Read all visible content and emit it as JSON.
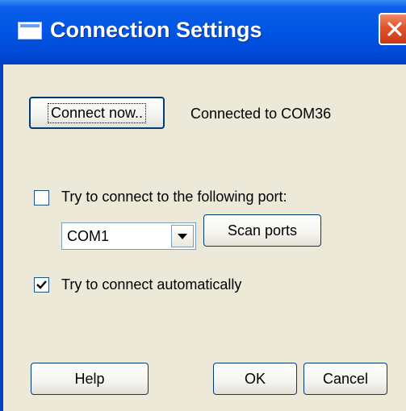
{
  "window": {
    "title": "Connection Settings"
  },
  "connect": {
    "button_label": "Connect now..",
    "status_text": "Connected to COM36"
  },
  "port": {
    "checkbox_label": "Try to connect to the following port:",
    "checked": false,
    "selected_port": "COM1",
    "scan_label": "Scan ports"
  },
  "auto": {
    "checkbox_label": "Try to connect automatically",
    "checked": true
  },
  "footer": {
    "help_label": "Help",
    "ok_label": "OK",
    "cancel_label": "Cancel"
  },
  "icons": {
    "window_icon": "window-icon",
    "close": "close-icon",
    "dropdown": "chevron-down-icon",
    "check": "checkmark-icon"
  },
  "colors": {
    "titlebar": "#0055e5",
    "face": "#ece9d8",
    "close": "#e3532a"
  }
}
